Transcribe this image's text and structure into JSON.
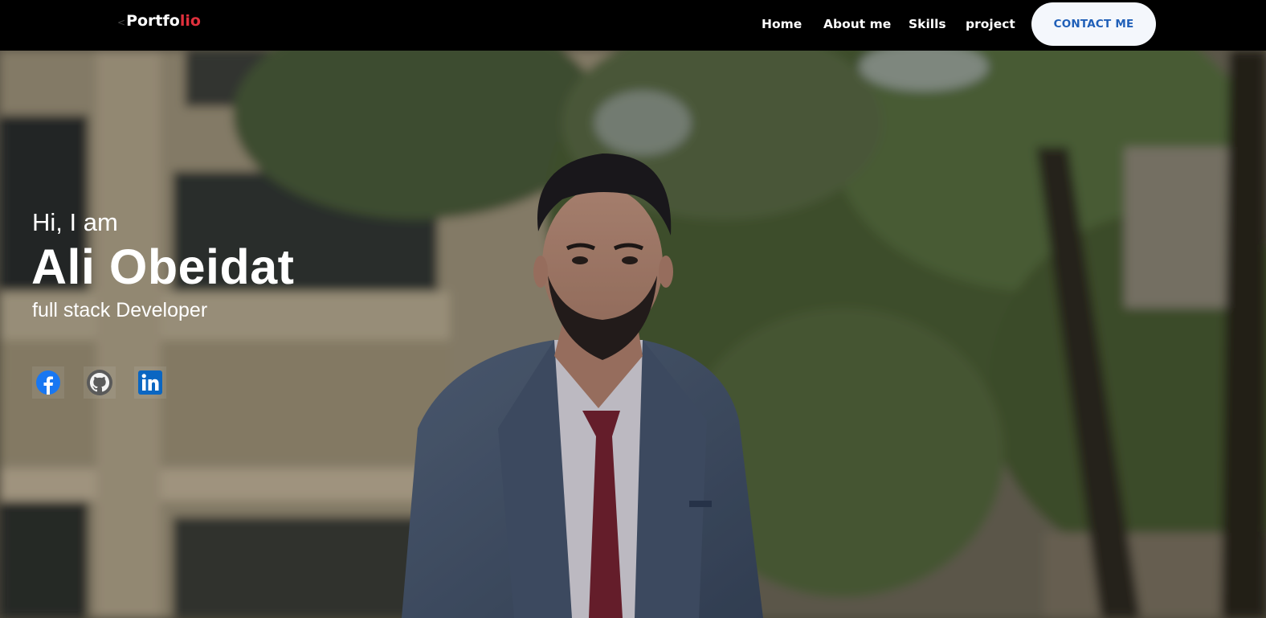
{
  "navbar": {
    "logo_lt": "<",
    "logo_main": "Portfo",
    "logo_accent": "lio",
    "links": [
      "Home",
      "About me",
      "Skills",
      "project"
    ],
    "contact_label": "CONTACT ME"
  },
  "hero": {
    "greeting": "Hi, I am",
    "name": "Ali Obeidat",
    "role": "full stack Developer"
  },
  "social": [
    {
      "icon": "facebook-icon",
      "color": "#1877f2"
    },
    {
      "icon": "github-icon",
      "color": "#555555"
    },
    {
      "icon": "linkedin-icon",
      "color": "#0a66c2"
    }
  ],
  "colors": {
    "logo_accent": "#e0303c",
    "contact_text": "#1f5fb8",
    "contact_bg": "#f4f7fc"
  }
}
